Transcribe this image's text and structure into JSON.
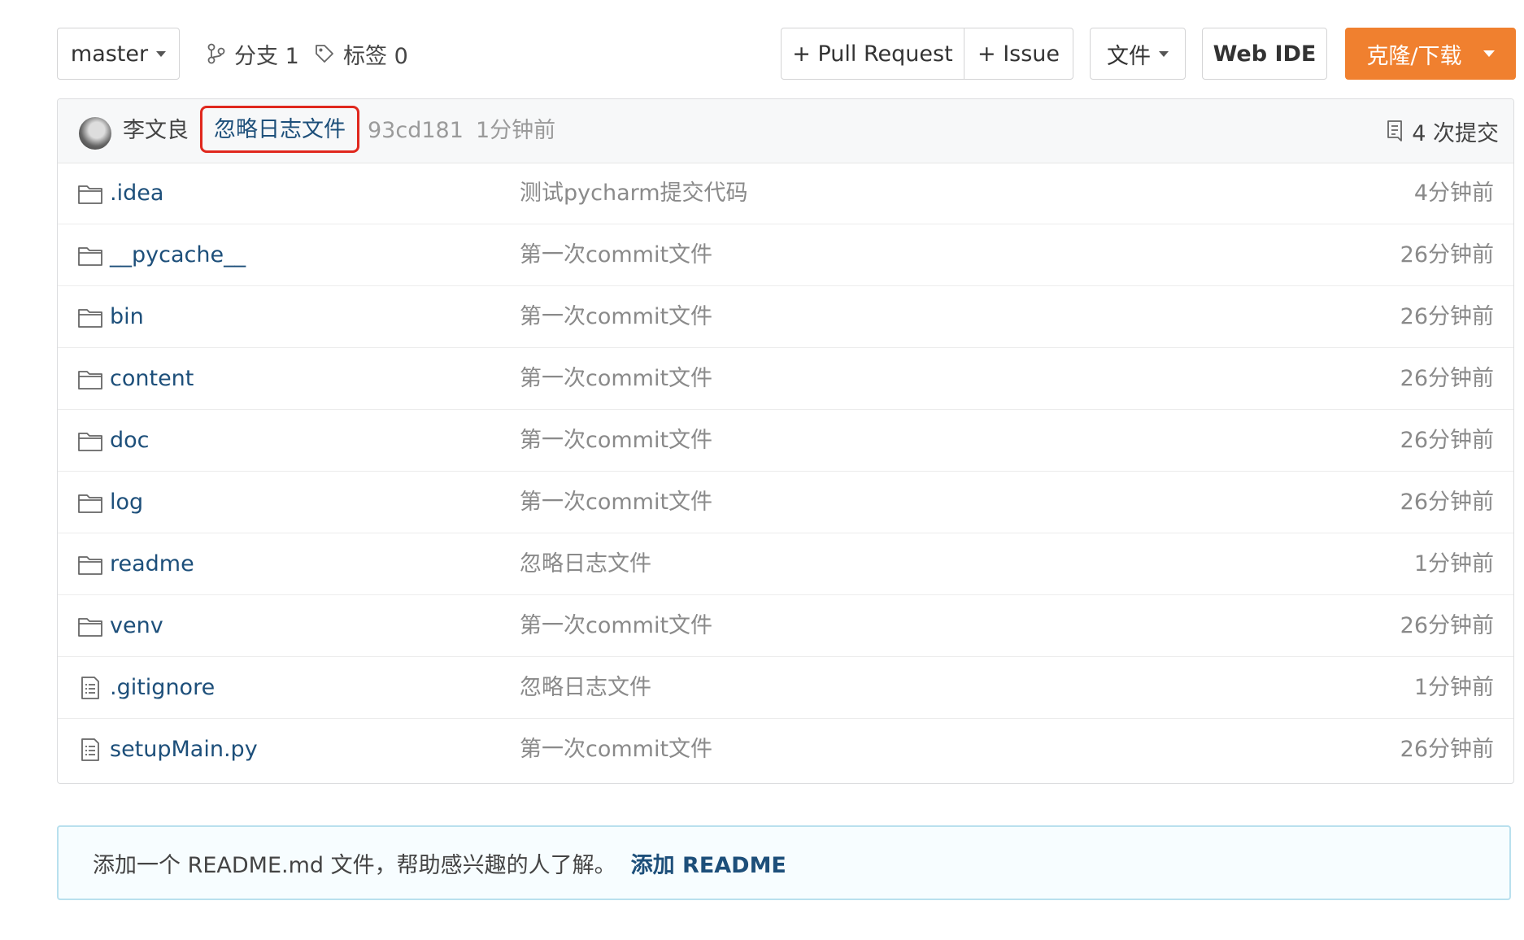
{
  "toolbar": {
    "branch_selector": "master",
    "branches_label": "分支 1",
    "tags_label": "标签 0",
    "pull_request_label": "+ Pull Request",
    "issue_label": "+ Issue",
    "file_menu_label": "文件",
    "web_ide_label": "Web IDE",
    "clone_label": "克隆/下载"
  },
  "commit": {
    "author": "李文良",
    "message": "忽略日志文件",
    "hash": "93cd181",
    "time": "1分钟前",
    "commit_count": "4 次提交"
  },
  "files": [
    {
      "type": "folder",
      "name": ".idea",
      "message": "测试pycharm提交代码",
      "time": "4分钟前"
    },
    {
      "type": "folder",
      "name": "__pycache__",
      "message": "第一次commit文件",
      "time": "26分钟前"
    },
    {
      "type": "folder",
      "name": "bin",
      "message": "第一次commit文件",
      "time": "26分钟前"
    },
    {
      "type": "folder",
      "name": "content",
      "message": "第一次commit文件",
      "time": "26分钟前"
    },
    {
      "type": "folder",
      "name": "doc",
      "message": "第一次commit文件",
      "time": "26分钟前"
    },
    {
      "type": "folder",
      "name": "log",
      "message": "第一次commit文件",
      "time": "26分钟前"
    },
    {
      "type": "folder",
      "name": "readme",
      "message": "忽略日志文件",
      "time": "1分钟前"
    },
    {
      "type": "folder",
      "name": "venv",
      "message": "第一次commit文件",
      "time": "26分钟前"
    },
    {
      "type": "file",
      "name": ".gitignore",
      "message": "忽略日志文件",
      "time": "1分钟前"
    },
    {
      "type": "file",
      "name": "setupMain.py",
      "message": "第一次commit文件",
      "time": "26分钟前"
    }
  ],
  "readme_notice": {
    "text": "添加一个 README.md 文件，帮助感兴趣的人了解。",
    "link": "添加 README"
  },
  "colors": {
    "accent_orange": "#f0802f",
    "link_blue": "#1d4f7a",
    "highlight_red": "#e0281e"
  }
}
